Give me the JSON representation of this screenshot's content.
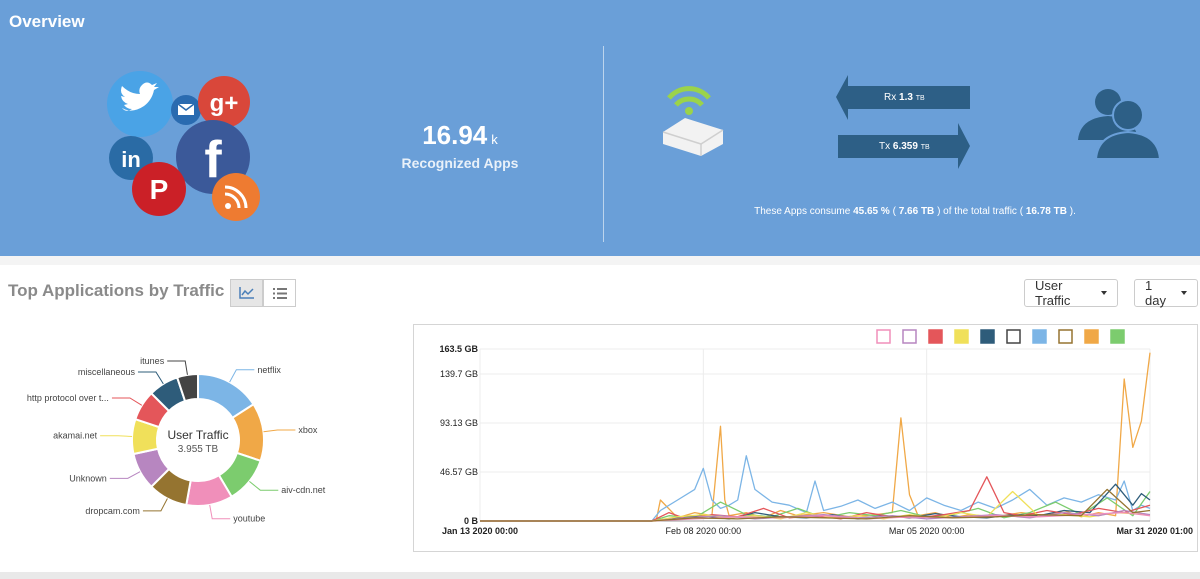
{
  "overview": {
    "title": "Overview",
    "apps_count": "16.94",
    "apps_unit": "k",
    "apps_label": "Recognized Apps",
    "rx_label": "Rx",
    "rx_value": "1.3",
    "rx_unit": "TB",
    "tx_label": "Tx",
    "tx_value": "6.359",
    "tx_unit": "TB",
    "consume_prefix": "These Apps consume",
    "consume_percent": "45.65 %",
    "consume_mid_open": "(",
    "consume_amount": "7.66 TB",
    "consume_mid_close": ") of the total traffic (",
    "consume_total": "16.78 TB",
    "consume_suffix": ").",
    "social_icons": [
      "twitter-icon",
      "mail-icon",
      "google-plus-icon",
      "linkedin-icon",
      "facebook-icon",
      "pinterest-icon",
      "rss-icon"
    ],
    "social_glyphs": {
      "gplus": "g+",
      "linkedin": "in",
      "facebook": "f",
      "pinterest": "P"
    }
  },
  "section": {
    "title": "Top Applications by Traffic",
    "traffic_dropdown": "User Traffic",
    "period_dropdown": "1 day"
  },
  "donut": {
    "center_label": "User Traffic",
    "center_value": "3.955 TB",
    "segments": [
      {
        "label": "netflix",
        "value": 14,
        "color": "#7cb5e6"
      },
      {
        "label": "xbox",
        "value": 12.5,
        "color": "#f0a847"
      },
      {
        "label": "aiv-cdn.net",
        "value": 10,
        "color": "#7ccc6e"
      },
      {
        "label": "youtube",
        "value": 10,
        "color": "#f08fba"
      },
      {
        "label": "dropcam.com",
        "value": 8.5,
        "color": "#957430"
      },
      {
        "label": "Unknown",
        "value": 8,
        "color": "#b786c0"
      },
      {
        "label": "akamai.net",
        "value": 7.5,
        "color": "#f0e05a"
      },
      {
        "label": "http protocol over t...",
        "value": 6.5,
        "color": "#e4565a"
      },
      {
        "label": "miscellaneous",
        "value": 6.5,
        "color": "#2e5c7a"
      },
      {
        "label": "itunes",
        "value": 4.5,
        "color": "#444444"
      }
    ]
  },
  "chart_data": {
    "type": "line",
    "y_ticks": [
      "0 B",
      "46.57 GB",
      "93.13 GB",
      "139.7 GB",
      "163.5 GB"
    ],
    "y_tick_values_gb": [
      0,
      46.57,
      93.13,
      139.7,
      163.5
    ],
    "ylim_gb": [
      0,
      163.5
    ],
    "x_ticks": [
      "Jan 13 2020 00:00",
      "Feb 08 2020 00:00",
      "Mar 05 2020 00:00",
      "Mar 31 2020 01:00"
    ],
    "x_tick_days": [
      0,
      26,
      52,
      78
    ],
    "grid": true,
    "legend": [
      {
        "color": "#f08fba",
        "style": "outline"
      },
      {
        "color": "#b786c0",
        "style": "outline"
      },
      {
        "color": "#e4565a",
        "style": "filled"
      },
      {
        "color": "#f0e05a",
        "style": "filled"
      },
      {
        "color": "#2e5c7a",
        "style": "filled"
      },
      {
        "color": "#444444",
        "style": "outline"
      },
      {
        "color": "#7cb5e6",
        "style": "filled"
      },
      {
        "color": "#957430",
        "style": "outline"
      },
      {
        "color": "#f0a847",
        "style": "filled"
      },
      {
        "color": "#7ccc6e",
        "style": "filled"
      }
    ],
    "series": [
      {
        "color": "#f0a847",
        "x": [
          0,
          20,
          20.5,
          21,
          23,
          25,
          27,
          28,
          28.5,
          29,
          31,
          33,
          35,
          37,
          40,
          43,
          46,
          48,
          49,
          50,
          51,
          53,
          55,
          57,
          60,
          63,
          66,
          68,
          70,
          72,
          74,
          75,
          76,
          77,
          78
        ],
        "y": [
          0,
          0,
          0,
          20,
          3,
          8,
          5,
          90,
          20,
          5,
          8,
          3,
          10,
          5,
          8,
          4,
          6,
          8,
          98,
          25,
          5,
          8,
          3,
          6,
          4,
          8,
          5,
          10,
          4,
          8,
          5,
          135,
          70,
          95,
          160
        ]
      },
      {
        "color": "#7cb5e6",
        "x": [
          0,
          20,
          21,
          23,
          25,
          26,
          27,
          28,
          29,
          30,
          31,
          32,
          34,
          36,
          38,
          39,
          40,
          42,
          44,
          46,
          48,
          50,
          52,
          54,
          56,
          58,
          60,
          62,
          64,
          66,
          68,
          70,
          72,
          74,
          75,
          76,
          77,
          78
        ],
        "y": [
          0,
          0,
          10,
          20,
          30,
          50,
          20,
          12,
          15,
          20,
          62,
          30,
          18,
          15,
          8,
          38,
          10,
          14,
          20,
          12,
          18,
          10,
          22,
          15,
          10,
          18,
          12,
          20,
          30,
          15,
          22,
          18,
          25,
          20,
          38,
          10,
          15,
          12
        ]
      },
      {
        "color": "#7ccc6e",
        "x": [
          0,
          20,
          22,
          25,
          28,
          31,
          34,
          37,
          40,
          43,
          46,
          49,
          52,
          55,
          58,
          61,
          64,
          67,
          70,
          73,
          76,
          78
        ],
        "y": [
          0,
          0,
          5,
          3,
          18,
          6,
          4,
          12,
          3,
          8,
          5,
          10,
          4,
          6,
          12,
          3,
          8,
          18,
          6,
          22,
          5,
          28
        ]
      },
      {
        "color": "#2e5c7a",
        "x": [
          0,
          20,
          23,
          26,
          29,
          32,
          35,
          38,
          41,
          44,
          47,
          50,
          53,
          56,
          59,
          62,
          65,
          68,
          71,
          74,
          76,
          77,
          78
        ],
        "y": [
          0,
          0,
          3,
          5,
          2,
          8,
          4,
          3,
          6,
          2,
          5,
          3,
          7,
          4,
          3,
          6,
          5,
          10,
          8,
          35,
          15,
          26,
          20
        ]
      },
      {
        "color": "#e4565a",
        "x": [
          0,
          20,
          22,
          24,
          27,
          30,
          33,
          36,
          39,
          42,
          45,
          48,
          51,
          54,
          57,
          59,
          61,
          63,
          66,
          69,
          72,
          75,
          78
        ],
        "y": [
          0,
          0,
          8,
          2,
          6,
          4,
          12,
          3,
          5,
          2,
          8,
          4,
          3,
          6,
          10,
          42,
          8,
          5,
          10,
          6,
          12,
          8,
          15
        ]
      },
      {
        "color": "#f0e05a",
        "x": [
          0,
          20,
          23,
          26,
          29,
          32,
          35,
          38,
          41,
          44,
          47,
          50,
          53,
          56,
          59,
          62,
          65,
          68,
          71,
          74,
          78
        ],
        "y": [
          0,
          0,
          4,
          6,
          3,
          5,
          2,
          8,
          3,
          5,
          2,
          6,
          3,
          8,
          4,
          28,
          5,
          6,
          4,
          8,
          6
        ]
      },
      {
        "color": "#b786c0",
        "x": [
          0,
          20,
          24,
          28,
          32,
          36,
          40,
          44,
          48,
          52,
          56,
          60,
          64,
          68,
          72,
          75,
          78
        ],
        "y": [
          0,
          0,
          3,
          5,
          2,
          4,
          6,
          3,
          5,
          2,
          4,
          6,
          3,
          8,
          5,
          10,
          6
        ]
      },
      {
        "color": "#f08fba",
        "x": [
          0,
          20,
          25,
          30,
          35,
          40,
          45,
          50,
          55,
          60,
          65,
          70,
          75,
          78
        ],
        "y": [
          0,
          0,
          2,
          4,
          3,
          5,
          2,
          4,
          3,
          5,
          4,
          6,
          8,
          5
        ]
      },
      {
        "color": "#957430",
        "x": [
          0,
          20,
          25,
          30,
          35,
          40,
          45,
          50,
          55,
          60,
          65,
          70,
          73,
          76,
          78
        ],
        "y": [
          0,
          0,
          3,
          2,
          4,
          3,
          2,
          5,
          3,
          4,
          6,
          5,
          30,
          8,
          10
        ]
      }
    ]
  }
}
